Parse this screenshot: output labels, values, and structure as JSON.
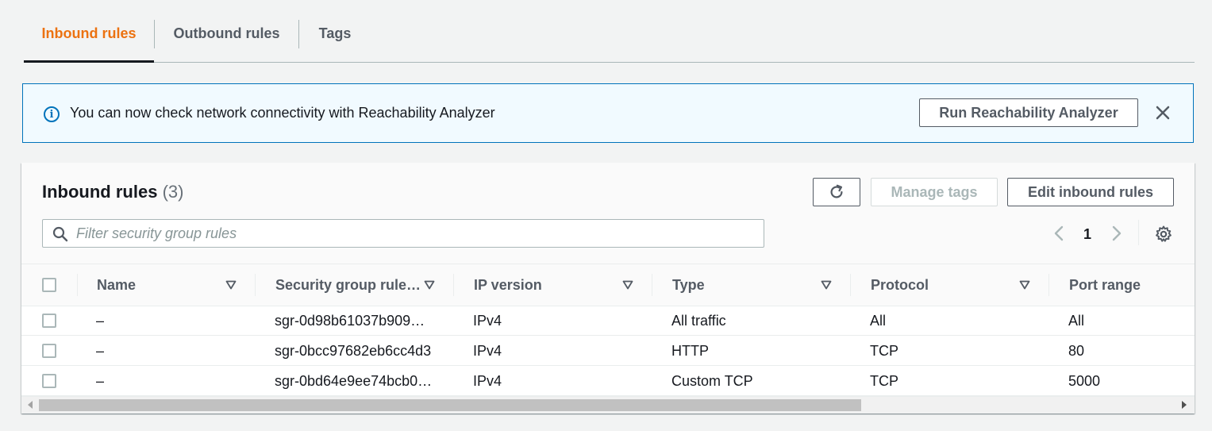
{
  "tabs": [
    {
      "label": "Inbound rules",
      "active": true
    },
    {
      "label": "Outbound rules",
      "active": false
    },
    {
      "label": "Tags",
      "active": false
    }
  ],
  "banner": {
    "message": "You can now check network connectivity with Reachability Analyzer",
    "button_label": "Run Reachability Analyzer",
    "icon": "info-icon"
  },
  "panel": {
    "title": "Inbound rules",
    "count": "(3)",
    "refresh_icon": "refresh-icon",
    "manage_tags_label": "Manage tags",
    "edit_label": "Edit inbound rules",
    "search_placeholder": "Filter security group rules",
    "page": "1"
  },
  "table": {
    "columns": [
      "Name",
      "Security group rule…",
      "IP version",
      "Type",
      "Protocol",
      "Port range"
    ],
    "rows": [
      {
        "name": "–",
        "rule_id": "sgr-0d98b61037b909…",
        "ip_version": "IPv4",
        "type": "All traffic",
        "protocol": "All",
        "port_range": "All"
      },
      {
        "name": "–",
        "rule_id": "sgr-0bcc97682eb6cc4d3",
        "ip_version": "IPv4",
        "type": "HTTP",
        "protocol": "TCP",
        "port_range": "80"
      },
      {
        "name": "–",
        "rule_id": "sgr-0bd64e9ee74bcb0…",
        "ip_version": "IPv4",
        "type": "Custom TCP",
        "protocol": "TCP",
        "port_range": "5000"
      }
    ]
  },
  "colors": {
    "accent_active_tab": "#ec7211",
    "info_blue": "#0073bb",
    "text_dark": "#16191f",
    "text_muted": "#545b64"
  }
}
